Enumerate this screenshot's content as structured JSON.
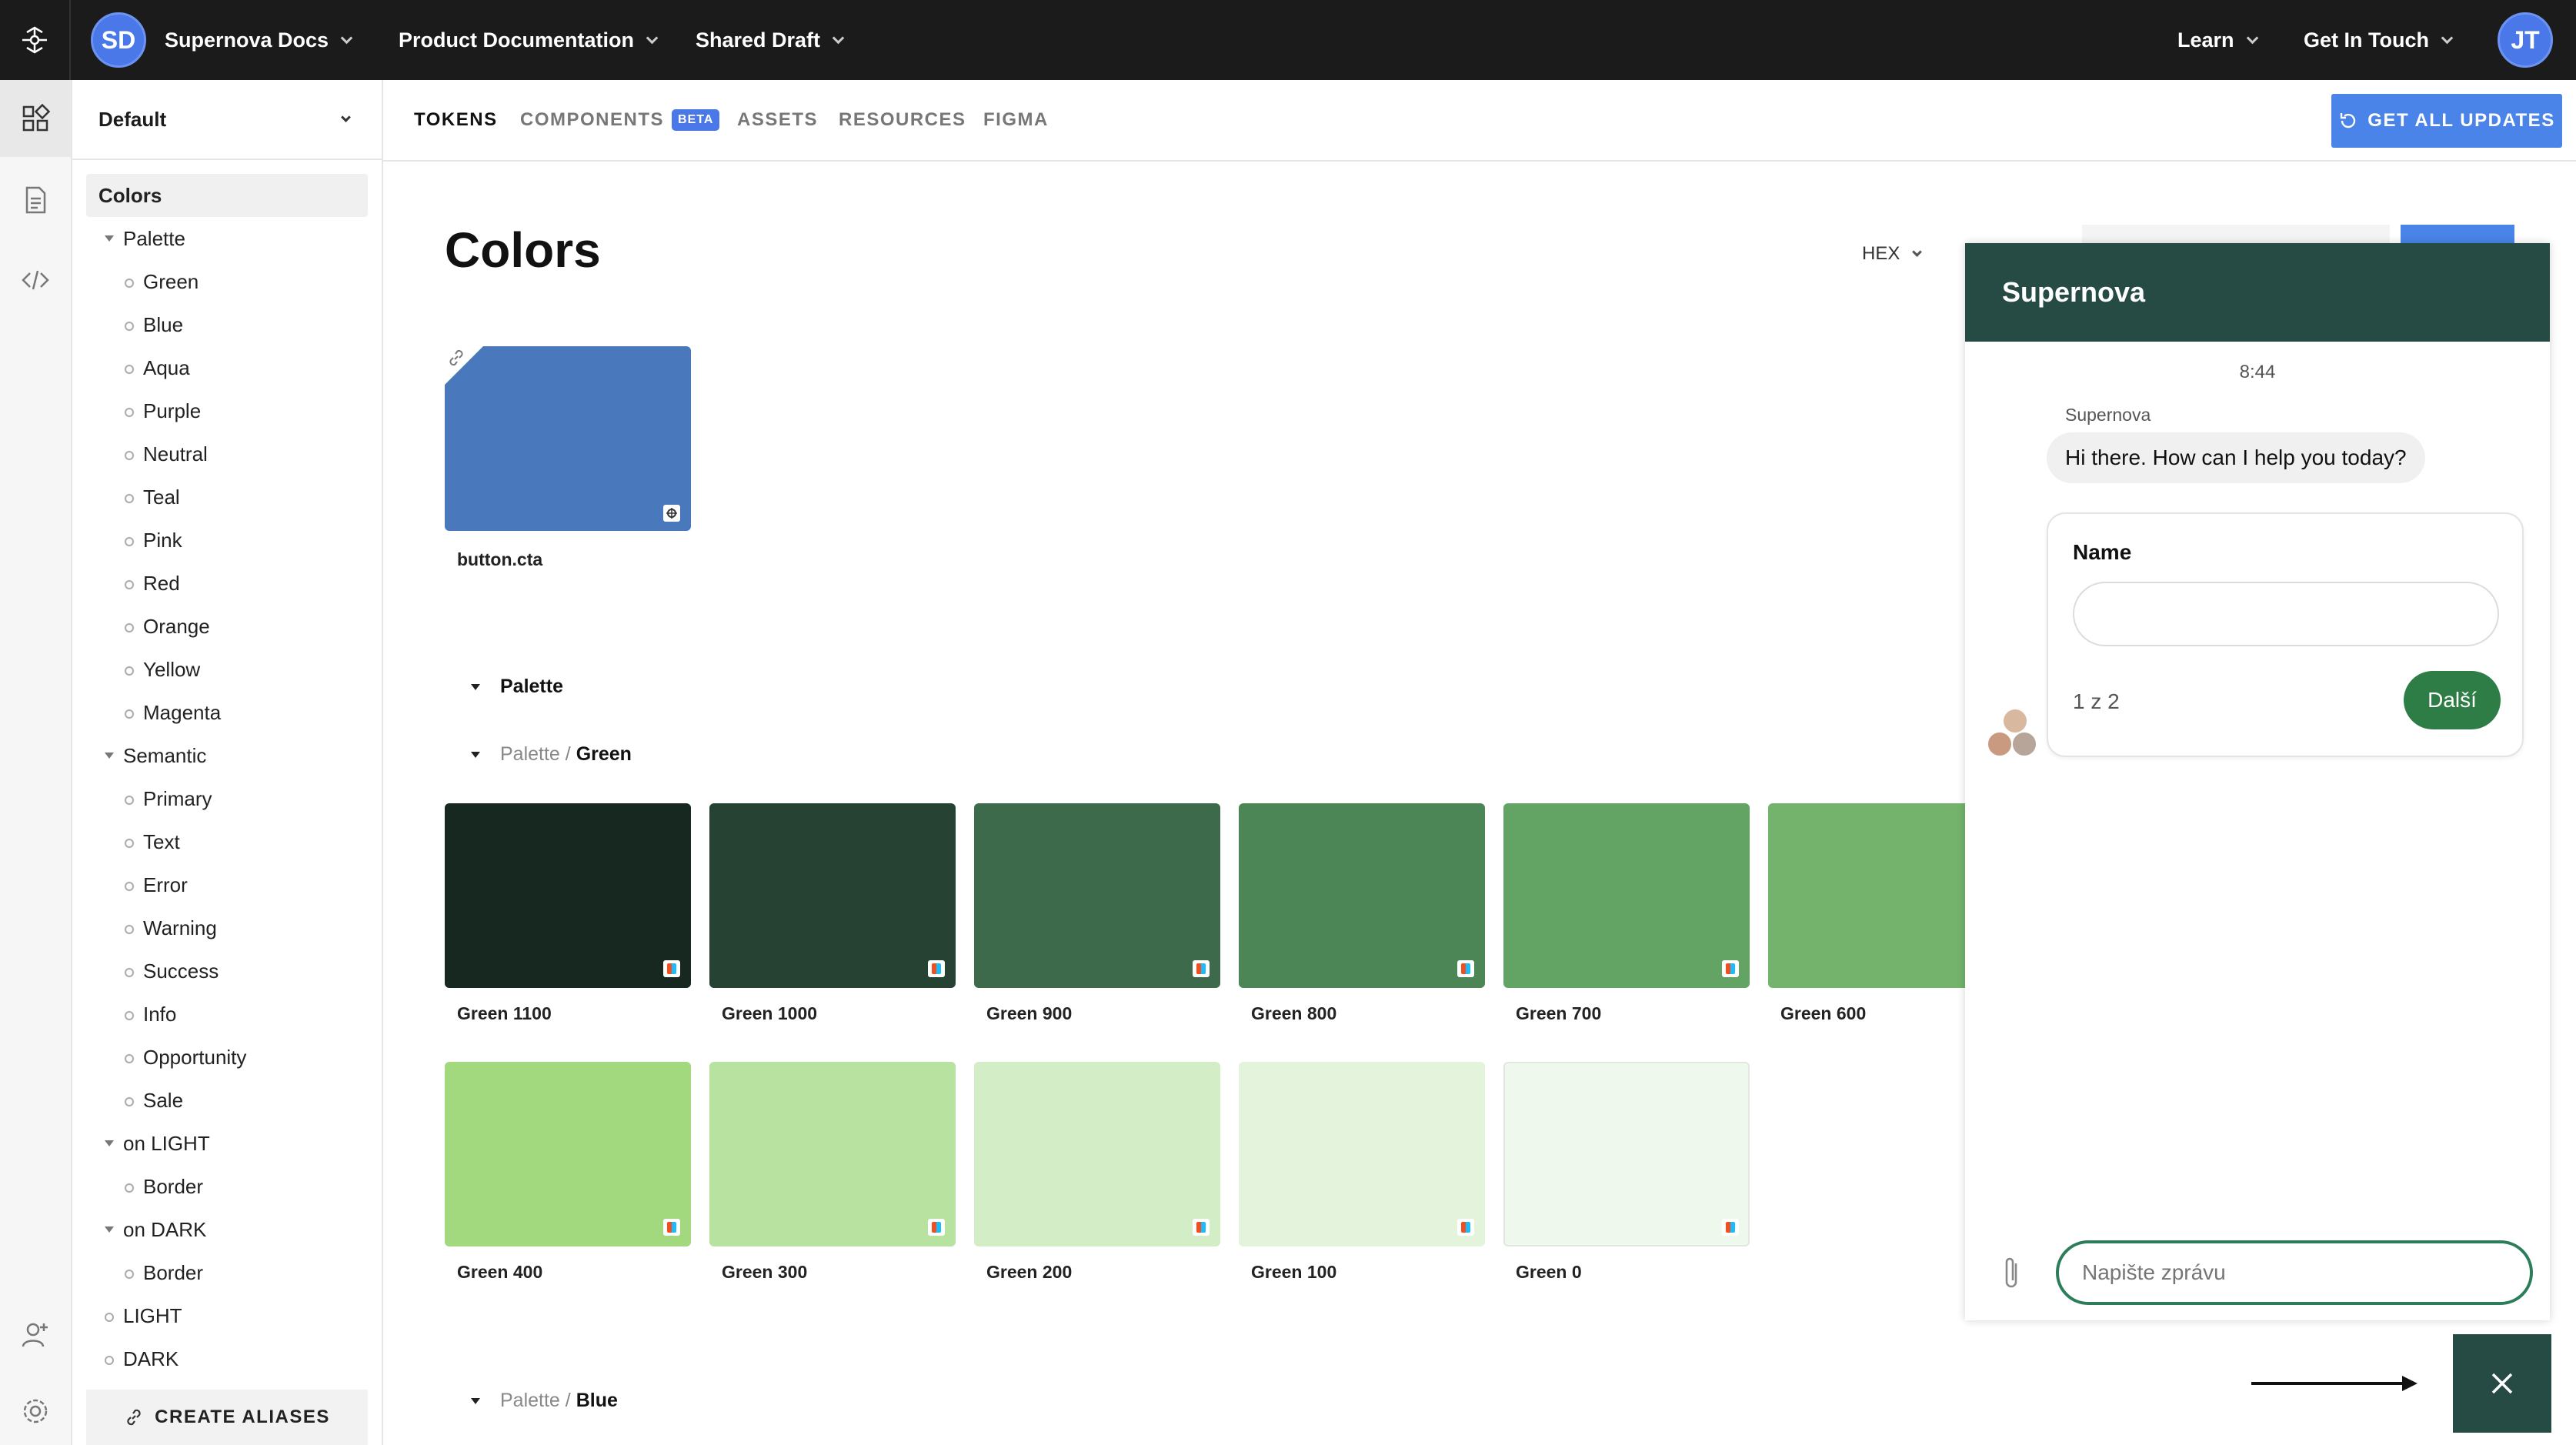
{
  "topbar": {
    "workspace_initials": "SD",
    "workspace_name": "Supernova Docs",
    "documentation": "Product Documentation",
    "draft": "Shared Draft",
    "learn": "Learn",
    "contact": "Get In Touch",
    "user_initials": "JT"
  },
  "sidebar": {
    "version": "Default",
    "items": [
      {
        "label": "Colors",
        "kind": "selected"
      },
      {
        "label": "Palette",
        "kind": "group"
      },
      {
        "label": "Green",
        "kind": "leaf"
      },
      {
        "label": "Blue",
        "kind": "leaf"
      },
      {
        "label": "Aqua",
        "kind": "leaf"
      },
      {
        "label": "Purple",
        "kind": "leaf"
      },
      {
        "label": "Neutral",
        "kind": "leaf"
      },
      {
        "label": "Teal",
        "kind": "leaf"
      },
      {
        "label": "Pink",
        "kind": "leaf"
      },
      {
        "label": "Red",
        "kind": "leaf"
      },
      {
        "label": "Orange",
        "kind": "leaf"
      },
      {
        "label": "Yellow",
        "kind": "leaf"
      },
      {
        "label": "Magenta",
        "kind": "leaf"
      },
      {
        "label": "Semantic",
        "kind": "group"
      },
      {
        "label": "Primary",
        "kind": "leaf"
      },
      {
        "label": "Text",
        "kind": "leaf"
      },
      {
        "label": "Error",
        "kind": "leaf"
      },
      {
        "label": "Warning",
        "kind": "leaf"
      },
      {
        "label": "Success",
        "kind": "leaf"
      },
      {
        "label": "Info",
        "kind": "leaf"
      },
      {
        "label": "Opportunity",
        "kind": "leaf"
      },
      {
        "label": "Sale",
        "kind": "leaf"
      },
      {
        "label": "on LIGHT",
        "kind": "group"
      },
      {
        "label": "Border",
        "kind": "leaf"
      },
      {
        "label": "on DARK",
        "kind": "group"
      },
      {
        "label": "Border",
        "kind": "leaf"
      },
      {
        "label": "LIGHT",
        "kind": "root-leaf"
      },
      {
        "label": "DARK",
        "kind": "root-leaf"
      }
    ],
    "create_aliases": "CREATE ALIASES"
  },
  "tabs": {
    "tokens": "TOKENS",
    "components": "COMPONENTS",
    "beta": "BETA",
    "assets": "ASSETS",
    "resources": "RESOURCES",
    "figma": "FIGMA",
    "updates": "GET ALL UPDATES"
  },
  "main": {
    "title": "Colors",
    "format": "HEX",
    "cta_swatch": {
      "label": "button.cta",
      "color": "#4a78bd"
    },
    "palette_heading": "Palette",
    "crumb_root": "Palette",
    "crumb_sep": "/",
    "green_heading": "Green",
    "blue_heading": "Blue",
    "greens": [
      {
        "name": "Green 1100",
        "color": "#172820"
      },
      {
        "name": "Green 1000",
        "color": "#264233"
      },
      {
        "name": "Green 900",
        "color": "#3c6a4a"
      },
      {
        "name": "Green 800",
        "color": "#4d8656"
      },
      {
        "name": "Green 700",
        "color": "#63a364"
      },
      {
        "name": "Green 600",
        "color": "#74b36c"
      },
      {
        "name": "Green 400",
        "color": "#a2d87e"
      },
      {
        "name": "Green 300",
        "color": "#b8e29f"
      },
      {
        "name": "Green 200",
        "color": "#d3edc6"
      },
      {
        "name": "Green 100",
        "color": "#e3f3dc"
      },
      {
        "name": "Green 0",
        "color": "#eef8ec"
      }
    ]
  },
  "chat": {
    "title": "Supernova",
    "time": "8:44",
    "sender": "Supernova",
    "message": "Hi there. How can I help you today?",
    "form_label": "Name",
    "step": "1 z 2",
    "next": "Další",
    "input_placeholder": "Napište zprávu",
    "accent": "#264a44"
  }
}
